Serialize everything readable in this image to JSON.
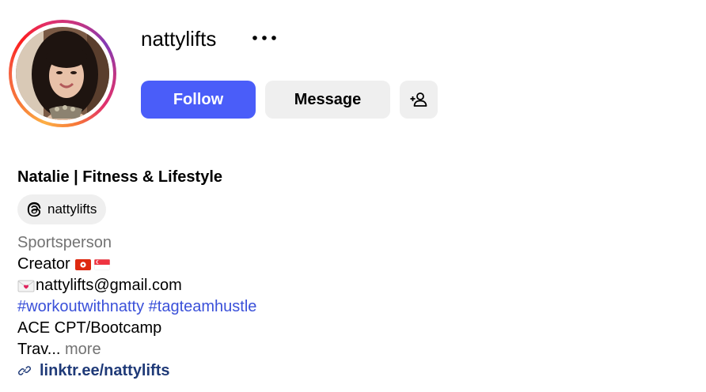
{
  "profile": {
    "username": "nattylifts",
    "full_name": "Natalie | Fitness & Lifestyle",
    "threads_handle": "nattylifts",
    "category": "Sportsperson",
    "bio": {
      "creator_text": "Creator",
      "email": "nattylifts@gmail.com",
      "hashtags": [
        "#workoutwithnatty",
        "#tagteamhustle"
      ],
      "credential": "ACE CPT/Bootcamp",
      "truncated_text": "Trav...",
      "more_label": "more"
    },
    "link_text": "linktr.ee/nattylifts"
  },
  "actions": {
    "follow_label": "Follow",
    "message_label": "Message"
  },
  "icons": {
    "options": "more-horizontal-icon",
    "suggest": "add-person-icon",
    "threads": "threads-icon",
    "link": "link-icon",
    "email": "love-letter-icon",
    "flags": [
      "hong-kong-flag-icon",
      "singapore-flag-icon"
    ]
  },
  "colors": {
    "follow_bg": "#4a5df9",
    "secondary_btn_bg": "#efefef",
    "hashtag": "#3a50d9",
    "link": "#1f3a78",
    "muted": "#737373"
  }
}
